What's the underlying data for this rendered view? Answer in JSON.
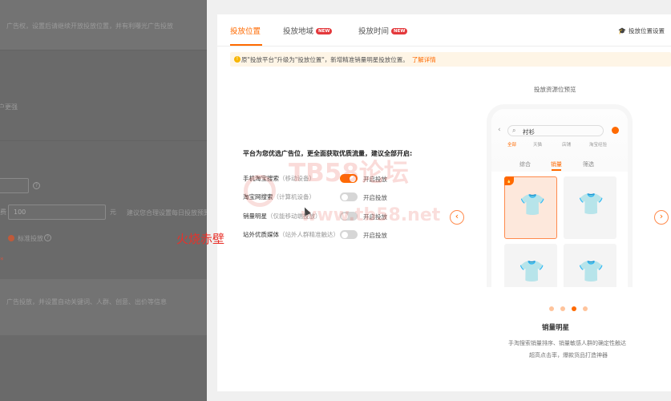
{
  "background": {
    "lines": [
      "广告权，设置后请继续开放投放位置，并有利曝光广告投放",
      "户更强"
    ],
    "input_value": "100",
    "unit": "元",
    "hint": "建议您合理设置每日投放预算，",
    "radio_label": "标准投放",
    "bottom_text": "广告投放，并设置自动关键词、人群、创意、出价等信息",
    "red_mark": "*"
  },
  "tabs": [
    {
      "label": "投放位置",
      "active": true,
      "badge": ""
    },
    {
      "label": "投放地域",
      "active": false,
      "badge": "NEW"
    },
    {
      "label": "投放时间",
      "active": false,
      "badge": "NEW"
    }
  ],
  "settings_link": "投放位置设置",
  "notice": {
    "text": "原\"投放平台\"升级为\"投放位置\"，新增精准销量明星投放位置。",
    "link": "了解详情"
  },
  "intro": "平台为您优选广告位，更全面获取优质流量，建议全部开启:",
  "options": [
    {
      "name": "手机淘宝搜索",
      "sub": "（移动设备）",
      "state_label": "开启投放",
      "on": true
    },
    {
      "name": "淘宝网搜索",
      "sub": "（计算机设备）",
      "state_label": "开启投放",
      "on": false
    },
    {
      "name": "销量明星",
      "sub": "（仅能移动端投放）",
      "state_label": "开启投放",
      "on": false
    },
    {
      "name": "站外优质媒体",
      "sub": "（站外人群精准触达）",
      "state_label": "开启投放",
      "on": false
    }
  ],
  "preview": {
    "title": "投放资源位预览",
    "search_text": "衬衫",
    "categories": [
      "全部",
      "天猫",
      "店铺",
      "淘宝经验"
    ],
    "sorts": [
      "综合",
      "销量",
      "筛选"
    ],
    "active_sort": "销量",
    "card_title": "销量明星",
    "card_desc_1": "手淘搜索销量排序、销量敏感人群的确定性触达",
    "card_desc_2": "超高点击率，爆款货品打造神器",
    "page_indicator": {
      "count": 4,
      "active_index": 2
    }
  },
  "watermark": {
    "title": "TB58论坛",
    "url": "www.tb58.net"
  },
  "overlay_text": "火烧赤壁",
  "colors": {
    "accent": "#ff6a00",
    "badge": "#e4393c",
    "notice_bg": "#fef5e6",
    "overlay_red": "#e8312a"
  }
}
